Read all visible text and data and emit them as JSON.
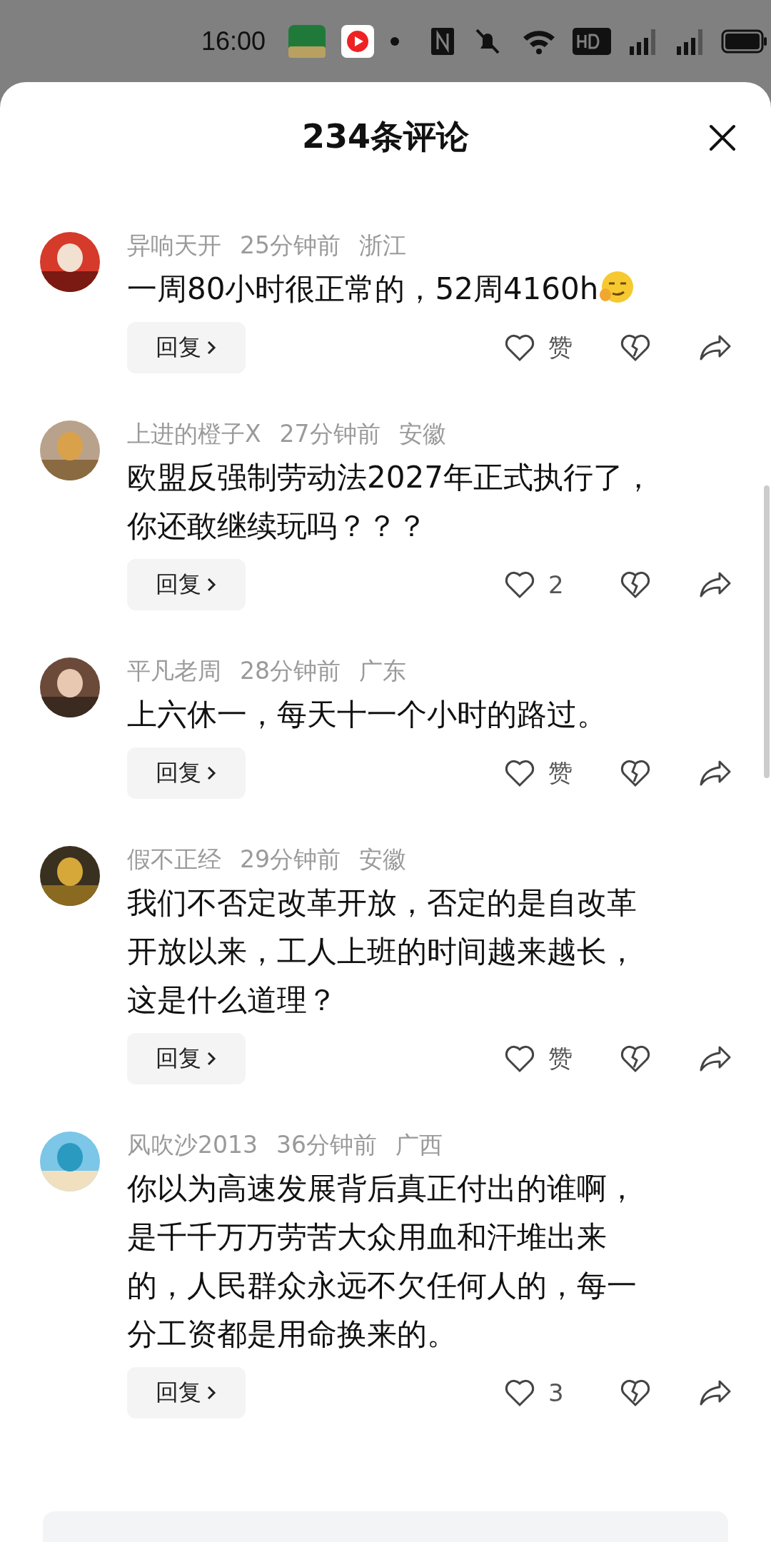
{
  "status_bar": {
    "time": "16:00"
  },
  "header": {
    "title": "234条评论"
  },
  "comments": [
    {
      "author": "异响天开",
      "time": "25分钟前",
      "region": "浙江",
      "text": "一周80小时很正常的，52周4160h",
      "emoji": true,
      "reply": "回复",
      "likes": "赞"
    },
    {
      "author": "上进的橙子X",
      "time": "27分钟前",
      "region": "安徽",
      "text": "欧盟反强制劳动法2027年正式执行了，你还敢继续玩吗？？？",
      "emoji": false,
      "reply": "回复",
      "likes": "2"
    },
    {
      "author": "平凡老周",
      "time": "28分钟前",
      "region": "广东",
      "text": "上六休一，每天十一个小时的路过。",
      "emoji": false,
      "reply": "回复",
      "likes": "赞"
    },
    {
      "author": "假不正经",
      "time": "29分钟前",
      "region": "安徽",
      "text": "我们不否定改革开放，否定的是自改革开放以来，工人上班的时间越来越长，这是什么道理？",
      "emoji": false,
      "reply": "回复",
      "likes": "赞"
    },
    {
      "author": "风吹沙2013",
      "time": "36分钟前",
      "region": "广西",
      "text": "你以为高速发展背后真正付出的谁啊，是千千万万劳苦大众用血和汗堆出来的，人民群众永远不欠任何人的，每一分工资都是用命换来的。",
      "emoji": false,
      "reply": "回复",
      "likes": "3"
    }
  ]
}
